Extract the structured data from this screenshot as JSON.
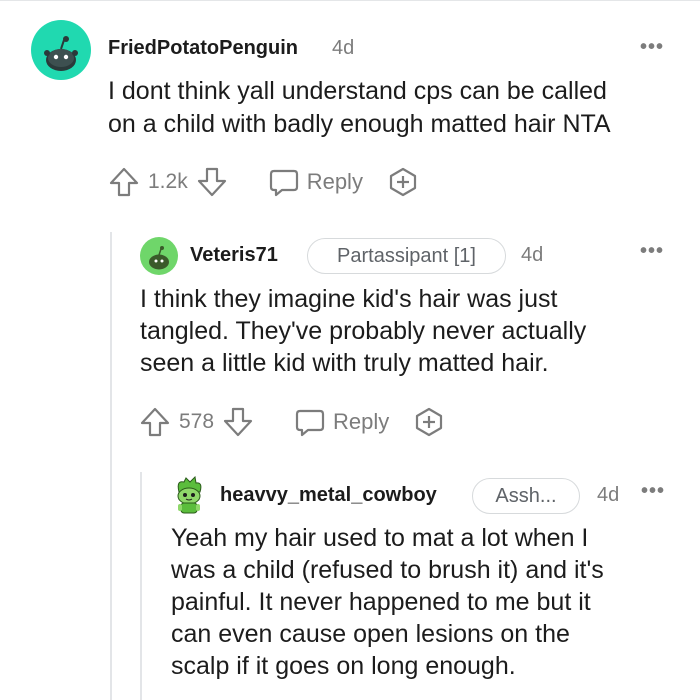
{
  "comments": [
    {
      "username": "FriedPotatoPenguin",
      "age": "4d",
      "body_lines": [
        "I dont think yall understand cps can be called",
        "on a child with badly enough matted hair NTA"
      ],
      "score": "1.2k",
      "reply_label": "Reply",
      "avatar_icon": "snoo-avatar-icon",
      "avatar_color": "#20d9b0"
    },
    {
      "username": "Veteris71",
      "flair": "Partassipant [1]",
      "age": "4d",
      "body_lines": [
        "I think they imagine kid's hair was just",
        "tangled. They've probably never actually",
        "seen a little kid with truly matted hair."
      ],
      "score": "578",
      "reply_label": "Reply",
      "avatar_icon": "snoo-avatar-icon",
      "avatar_color": "#6fd66a"
    },
    {
      "username": "heavvy_metal_cowboy",
      "flair": "Assh...",
      "age": "4d",
      "body_lines": [
        "Yeah my hair used to mat a lot when I",
        "was a child (refused to brush it) and it's",
        "painful. It never happened to me but it",
        "can even cause open lesions on the",
        "scalp if it goes on long enough."
      ],
      "avatar_icon": "snoo-character-avatar-icon",
      "avatar_color": "#5bbd3c"
    }
  ],
  "colors": {
    "text": "#1c1c1c",
    "meta": "#7c7c7c",
    "thread_line": "#e3e5e8",
    "flair_border": "#d7dadc"
  }
}
